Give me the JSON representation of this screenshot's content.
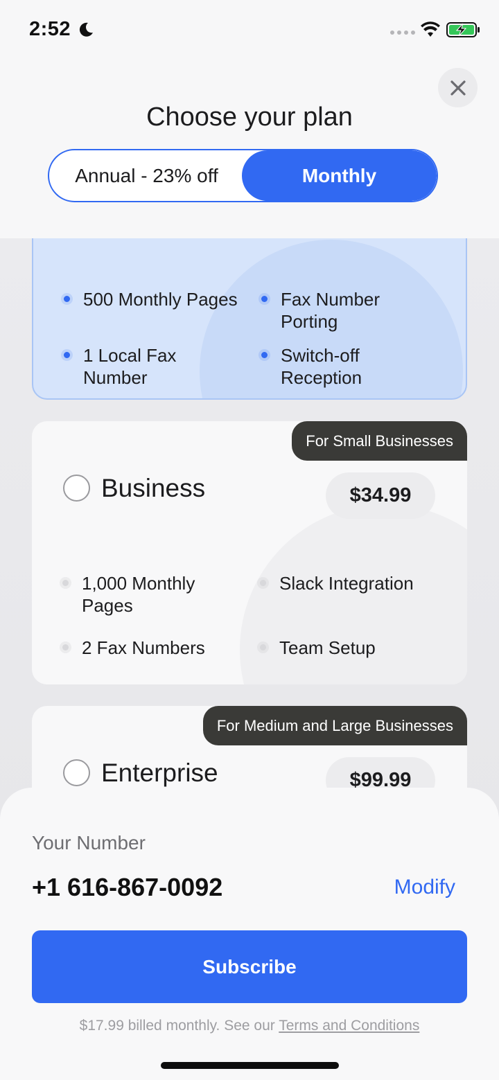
{
  "status_bar": {
    "time": "2:52",
    "icons": [
      "moon-icon",
      "signal-dots-icon",
      "wifi-icon",
      "battery-charging-icon"
    ]
  },
  "header": {
    "title": "Choose your plan",
    "close_icon": "close-icon",
    "toggle": {
      "annual_label": "Annual - 23% off",
      "monthly_label": "Monthly",
      "selected": "Monthly"
    }
  },
  "plans": [
    {
      "id": "selected",
      "features": [
        "500 Monthly Pages",
        "Fax Number Porting",
        "1 Local Fax Number",
        "Switch-off Reception"
      ]
    },
    {
      "id": "business",
      "tag": "For Small Businesses",
      "name": "Business",
      "price": "$34.99",
      "features": [
        "1,000 Monthly Pages",
        "Slack Integration",
        "2 Fax Numbers",
        "Team Setup"
      ]
    },
    {
      "id": "enterprise",
      "tag": "For Medium and Large Businesses",
      "name": "Enterprise",
      "price": "$99.99"
    }
  ],
  "bottom_sheet": {
    "number_label": "Your Number",
    "number_value": "+1 616-867-0092",
    "modify_label": "Modify",
    "subscribe_label": "Subscribe",
    "billing_text": "$17.99 billed monthly. See our ",
    "terms_label": "Terms and Conditions"
  },
  "colors": {
    "accent": "#3169f2",
    "tag_background": "#3a3a37",
    "selected_card": "#d6e4fb"
  }
}
